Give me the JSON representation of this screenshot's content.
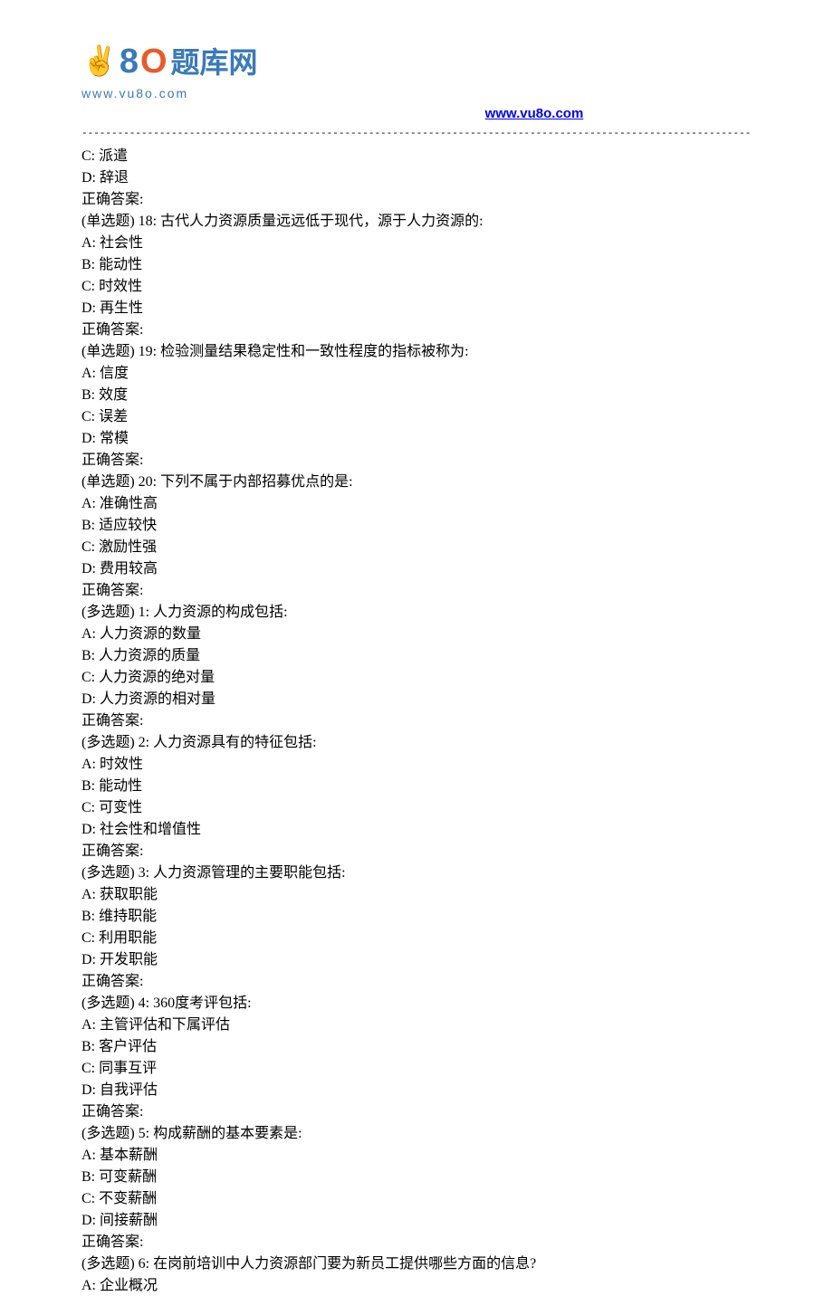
{
  "header": {
    "url_text": "www.vu8o.com",
    "logo_url": "www.vu8o.com",
    "logo_chinese": "题库网"
  },
  "lines": [
    "C: 派遣",
    "D: 辞退",
    "正确答案:",
    "(单选题) 18: 古代人力资源质量远远低于现代，源于人力资源的:",
    "A: 社会性",
    "B: 能动性",
    "C: 时效性",
    "D: 再生性",
    "正确答案:",
    "(单选题) 19: 检验测量结果稳定性和一致性程度的指标被称为:",
    "A: 信度",
    "B: 效度",
    "C: 误差",
    "D: 常模",
    "正确答案:",
    "(单选题) 20: 下列不属于内部招募优点的是:",
    "A: 准确性高",
    "B: 适应较快",
    "C: 激励性强",
    "D: 费用较高",
    "正确答案:",
    "(多选题) 1: 人力资源的构成包括:",
    "A: 人力资源的数量",
    "B: 人力资源的质量",
    "C: 人力资源的绝对量",
    "D: 人力资源的相对量",
    "正确答案:",
    "(多选题) 2: 人力资源具有的特征包括:",
    "A: 时效性",
    "B: 能动性",
    "C: 可变性",
    "D: 社会性和增值性",
    "正确答案:",
    "(多选题) 3: 人力资源管理的主要职能包括:",
    "A: 获取职能",
    "B: 维持职能",
    "C: 利用职能",
    "D: 开发职能",
    "正确答案:",
    "(多选题) 4: 360度考评包括:",
    "A: 主管评估和下属评估",
    "B: 客户评估",
    "C: 同事互评",
    "D: 自我评估",
    "正确答案:",
    "(多选题) 5: 构成薪酬的基本要素是:",
    "A: 基本薪酬",
    "B: 可变薪酬",
    "C: 不变薪酬",
    "D: 间接薪酬",
    "正确答案:",
    "(多选题) 6: 在岗前培训中人力资源部门要为新员工提供哪些方面的信息?",
    "A: 企业概况"
  ]
}
